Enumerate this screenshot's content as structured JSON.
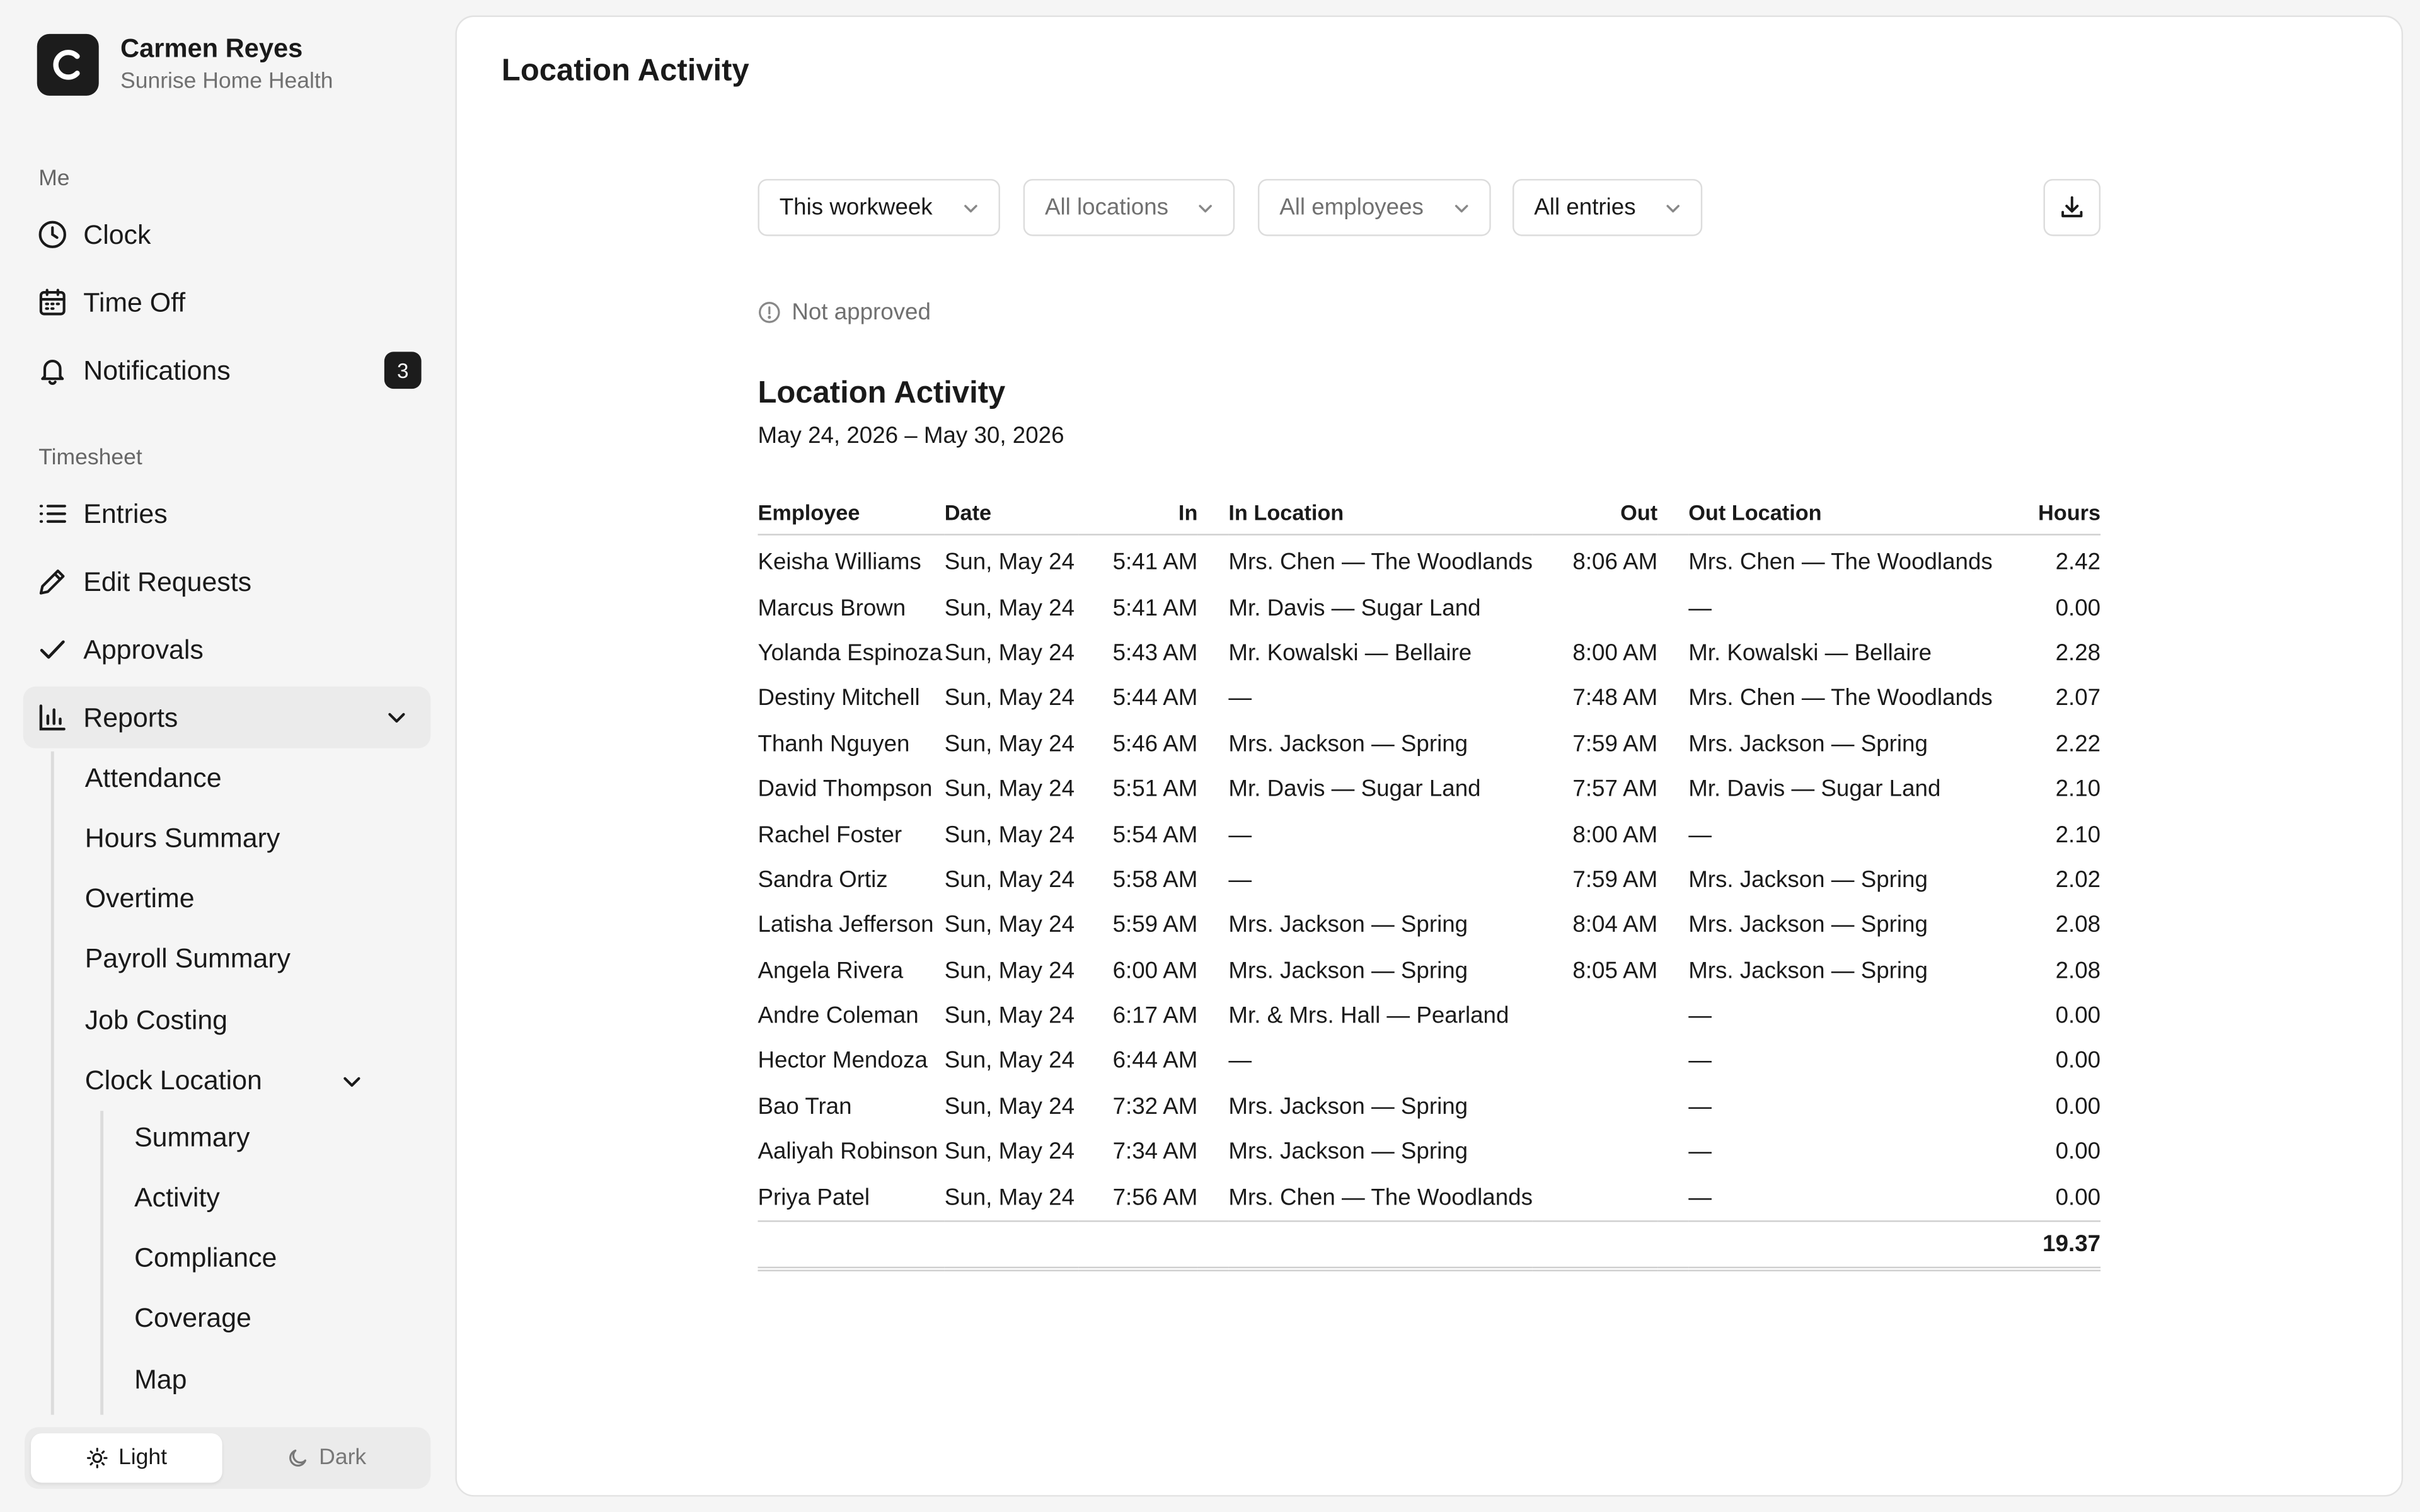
{
  "user": {
    "initial": "C",
    "name": "Carmen Reyes",
    "org": "Sunrise Home Health"
  },
  "sidebar": {
    "me_label": "Me",
    "me_items": [
      {
        "label": "Clock",
        "icon": "clock-icon"
      },
      {
        "label": "Time Off",
        "icon": "calendar-icon"
      },
      {
        "label": "Notifications",
        "icon": "bell-icon",
        "badge": "3"
      }
    ],
    "timesheet_label": "Timesheet",
    "timesheet_items": [
      {
        "label": "Entries",
        "icon": "list-icon"
      },
      {
        "label": "Edit Requests",
        "icon": "pencil-icon"
      },
      {
        "label": "Approvals",
        "icon": "check-icon"
      },
      {
        "label": "Reports",
        "icon": "bar-chart-icon"
      }
    ],
    "report_items": [
      "Attendance",
      "Hours Summary",
      "Overtime",
      "Payroll Summary",
      "Job Costing",
      "Clock Location"
    ],
    "clock_location_items": [
      "Summary",
      "Activity",
      "Compliance",
      "Coverage",
      "Map"
    ],
    "theme": {
      "light": "Light",
      "dark": "Dark",
      "selected": "Light"
    }
  },
  "page": {
    "title": "Location Activity"
  },
  "filters": {
    "period": "This workweek",
    "locations": "All locations",
    "employees": "All employees",
    "entries": "All entries"
  },
  "status": "Not approved",
  "report": {
    "title": "Location Activity",
    "range": "May 24, 2026 – May 30, 2026",
    "columns": [
      "Employee",
      "Date",
      "In",
      "In Location",
      "Out",
      "Out Location",
      "Hours"
    ],
    "rows": [
      [
        "Keisha Williams",
        "Sun, May 24",
        "5:41 AM",
        "Mrs. Chen — The Woodlands",
        "8:06 AM",
        "Mrs. Chen — The Woodlands",
        "2.42"
      ],
      [
        "Marcus Brown",
        "Sun, May 24",
        "5:41 AM",
        "Mr. Davis — Sugar Land",
        "",
        "—",
        "0.00"
      ],
      [
        "Yolanda Espinoza",
        "Sun, May 24",
        "5:43 AM",
        "Mr. Kowalski — Bellaire",
        "8:00 AM",
        "Mr. Kowalski — Bellaire",
        "2.28"
      ],
      [
        "Destiny Mitchell",
        "Sun, May 24",
        "5:44 AM",
        "—",
        "7:48 AM",
        "Mrs. Chen — The Woodlands",
        "2.07"
      ],
      [
        "Thanh Nguyen",
        "Sun, May 24",
        "5:46 AM",
        "Mrs. Jackson — Spring",
        "7:59 AM",
        "Mrs. Jackson — Spring",
        "2.22"
      ],
      [
        "David Thompson",
        "Sun, May 24",
        "5:51 AM",
        "Mr. Davis — Sugar Land",
        "7:57 AM",
        "Mr. Davis — Sugar Land",
        "2.10"
      ],
      [
        "Rachel Foster",
        "Sun, May 24",
        "5:54 AM",
        "—",
        "8:00 AM",
        "—",
        "2.10"
      ],
      [
        "Sandra Ortiz",
        "Sun, May 24",
        "5:58 AM",
        "—",
        "7:59 AM",
        "Mrs. Jackson — Spring",
        "2.02"
      ],
      [
        "Latisha Jefferson",
        "Sun, May 24",
        "5:59 AM",
        "Mrs. Jackson — Spring",
        "8:04 AM",
        "Mrs. Jackson — Spring",
        "2.08"
      ],
      [
        "Angela Rivera",
        "Sun, May 24",
        "6:00 AM",
        "Mrs. Jackson — Spring",
        "8:05 AM",
        "Mrs. Jackson — Spring",
        "2.08"
      ],
      [
        "Andre Coleman",
        "Sun, May 24",
        "6:17 AM",
        "Mr. & Mrs. Hall — Pearland",
        "",
        "—",
        "0.00"
      ],
      [
        "Hector Mendoza",
        "Sun, May 24",
        "6:44 AM",
        "—",
        "",
        "—",
        "0.00"
      ],
      [
        "Bao Tran",
        "Sun, May 24",
        "7:32 AM",
        "Mrs. Jackson — Spring",
        "",
        "—",
        "0.00"
      ],
      [
        "Aaliyah Robinson",
        "Sun, May 24",
        "7:34 AM",
        "Mrs. Jackson — Spring",
        "",
        "—",
        "0.00"
      ],
      [
        "Priya Patel",
        "Sun, May 24",
        "7:56 AM",
        "Mrs. Chen — The Woodlands",
        "",
        "—",
        "0.00"
      ]
    ],
    "total": "19.37"
  }
}
